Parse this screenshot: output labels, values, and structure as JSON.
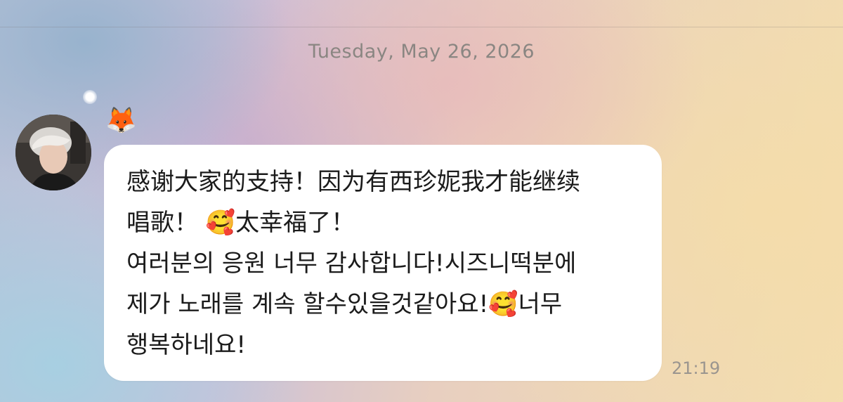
{
  "chat": {
    "date_separator": "Tuesday, May 26, 2026",
    "sender": {
      "name_emoji": "🦊",
      "avatar_icon": "avatar-photo"
    },
    "message": {
      "lines": [
        "感谢大家的支持！因为有西珍妮我才能继续",
        "唱歌！ 🥰太幸福了！",
        "여러분의 응원 너무 감사합니다!시즈니떡분에",
        "제가 노래를 계속 할수있을것같아요!🥰너무",
        "행복하네요!"
      ],
      "time": "21:19"
    }
  },
  "colors": {
    "bubble": "#ffffff",
    "text": "#1b1b1b",
    "meta_text": "#8a8682"
  }
}
